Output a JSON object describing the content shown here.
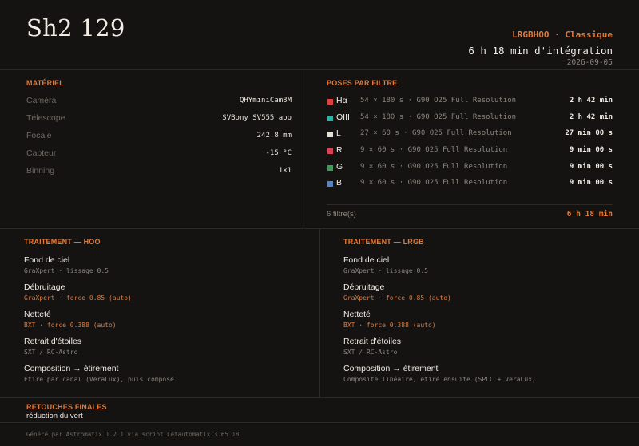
{
  "header": {
    "title": "Sh2 129",
    "preset": "LRGBHOO · Classique",
    "integration": "6 h 18 min d'intégration",
    "date": "2026-09-05"
  },
  "materiel": {
    "title": "MATÉRIEL",
    "rows": [
      {
        "label": "Caméra",
        "value": "QHYminiCam8M"
      },
      {
        "label": "Télescope",
        "value": "SVBony SV555 apo"
      },
      {
        "label": "Focale",
        "value": "242.8 mm"
      },
      {
        "label": "Capteur",
        "value": "-15 °C"
      },
      {
        "label": "Binning",
        "value": "1×1"
      }
    ]
  },
  "poses": {
    "title": "POSES PAR FILTRE",
    "filters": [
      {
        "name": "Hα",
        "color": "#e0413c",
        "desc": "54 × 180 s · G90 O25 Full Resolution",
        "time": "2 h 42 min"
      },
      {
        "name": "OIII",
        "color": "#2bb3a3",
        "desc": "54 × 180 s · G90 O25 Full Resolution",
        "time": "2 h 42 min"
      },
      {
        "name": "L",
        "color": "#e6e1d6",
        "desc": "27 × 60 s · G90 O25 Full Resolution",
        "time": "27 min 00 s"
      },
      {
        "name": "R",
        "color": "#d8434f",
        "desc": "9 × 60 s · G90 O25 Full Resolution",
        "time": "9 min 00 s"
      },
      {
        "name": "G",
        "color": "#3e9c5a",
        "desc": "9 × 60 s · G90 O25 Full Resolution",
        "time": "9 min 00 s"
      },
      {
        "name": "B",
        "color": "#4f86c6",
        "desc": "9 × 60 s · G90 O25 Full Resolution",
        "time": "9 min 00 s"
      }
    ],
    "count": "6 filtre(s)",
    "total": "6 h 18 min"
  },
  "traitement_hoo": {
    "title": "TRAITEMENT — HOO",
    "steps": [
      {
        "name": "Fond de ciel",
        "detail": "GraXpert · lissage 0.5",
        "accent": false
      },
      {
        "name": "Débruitage",
        "detail": "GraXpert · force 0.85 (auto)",
        "accent": true
      },
      {
        "name": "Netteté",
        "detail": "BXT · force 0.388 (auto)",
        "accent": true
      },
      {
        "name": "Retrait d'étoiles",
        "detail": "SXT / RC-Astro",
        "accent": false
      },
      {
        "name": "Composition → étirement",
        "detail": "Étiré par canal (VeraLux), puis composé",
        "accent": false
      }
    ]
  },
  "traitement_lrgb": {
    "title": "TRAITEMENT — LRGB",
    "steps": [
      {
        "name": "Fond de ciel",
        "detail": "GraXpert · lissage 0.5",
        "accent": false
      },
      {
        "name": "Débruitage",
        "detail": "GraXpert · force 0.85 (auto)",
        "accent": true
      },
      {
        "name": "Netteté",
        "detail": "BXT · force 0.388 (auto)",
        "accent": true
      },
      {
        "name": "Retrait d'étoiles",
        "detail": "SXT / RC-Astro",
        "accent": false
      },
      {
        "name": "Composition → étirement",
        "detail": "Composite linéaire, étiré ensuite (SPCC + VeraLux)",
        "accent": false
      }
    ]
  },
  "retouches": {
    "title": "RETOUCHES FINALES",
    "text": "réduction du vert"
  },
  "footer": "Généré par Astromatix 1.2.1 via script Cétautomatix 3.65.18",
  "colors": {
    "accent": "#e07a3a",
    "background": "#141312"
  }
}
